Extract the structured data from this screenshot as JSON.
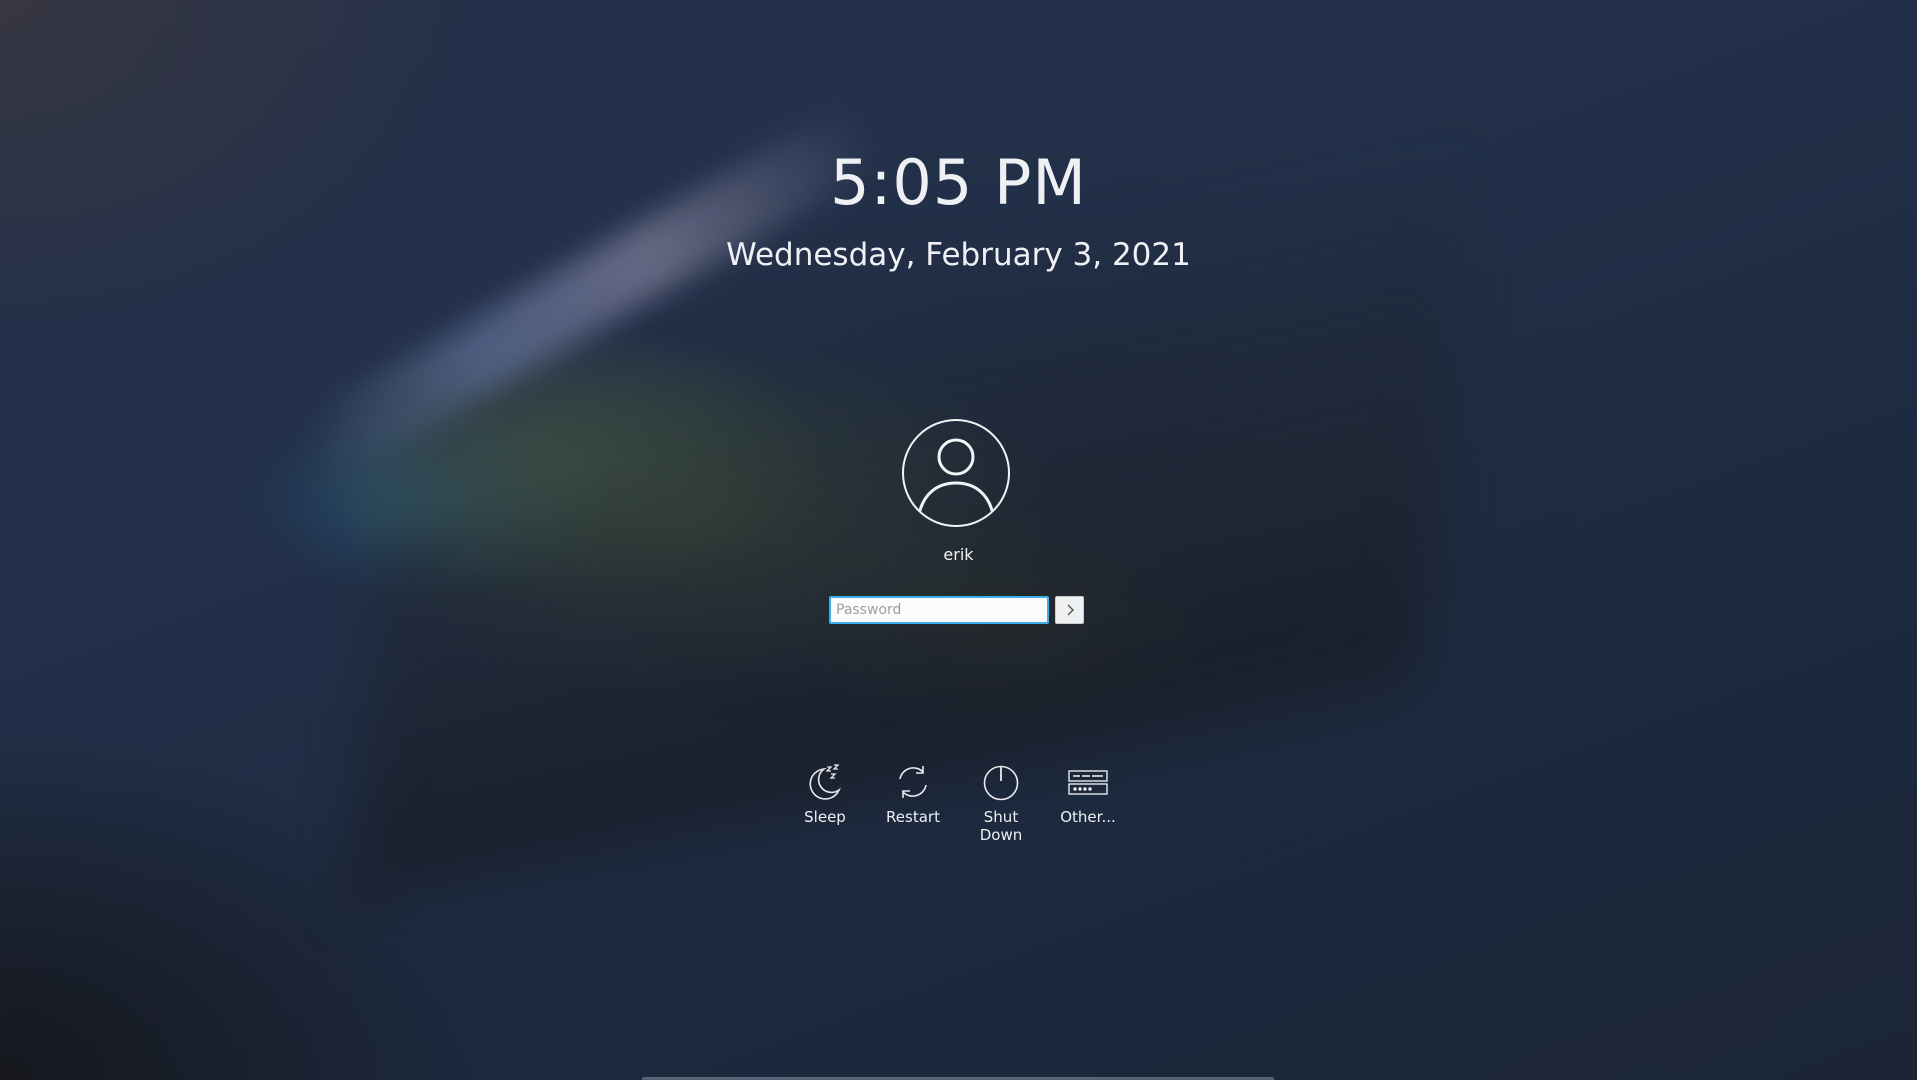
{
  "lockscreen": {
    "time": "5:05 PM",
    "date": "Wednesday, February 3, 2021",
    "user": {
      "name": "erik",
      "avatar_icon": "user-avatar-icon"
    },
    "password": {
      "value": "",
      "placeholder": "Password"
    },
    "submit_icon": "chevron-right-icon"
  },
  "actions": [
    {
      "label": "Sleep",
      "icon": "sleep-moon-icon"
    },
    {
      "label": "Restart",
      "icon": "restart-icon"
    },
    {
      "label": "Shut\nDown",
      "icon": "power-icon"
    },
    {
      "label": "Other...",
      "icon": "switch-user-icon"
    }
  ],
  "colors": {
    "accent": "#3daee9",
    "text": "#eef0f4"
  }
}
